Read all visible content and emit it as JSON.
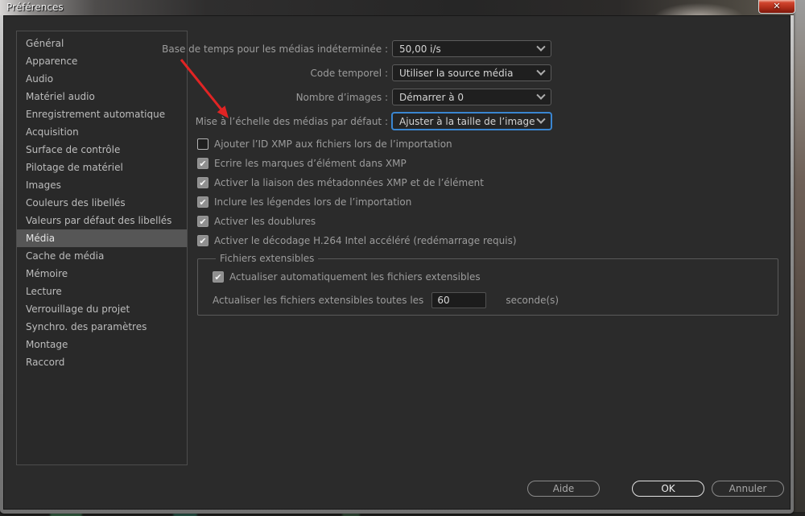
{
  "window": {
    "title": "Préférences"
  },
  "icons": {
    "close": "✕",
    "checkmark": "✔"
  },
  "sidebar": {
    "items": [
      {
        "label": "Général"
      },
      {
        "label": "Apparence"
      },
      {
        "label": "Audio"
      },
      {
        "label": "Matériel audio"
      },
      {
        "label": "Enregistrement automatique"
      },
      {
        "label": "Acquisition"
      },
      {
        "label": "Surface de contrôle"
      },
      {
        "label": "Pilotage de matériel"
      },
      {
        "label": "Images"
      },
      {
        "label": "Couleurs des libellés"
      },
      {
        "label": "Valeurs par défaut des libellés"
      },
      {
        "label": "Média",
        "selected": true
      },
      {
        "label": "Cache de média"
      },
      {
        "label": "Mémoire"
      },
      {
        "label": "Lecture"
      },
      {
        "label": "Verrouillage du projet"
      },
      {
        "label": "Synchro. des paramètres"
      },
      {
        "label": "Montage"
      },
      {
        "label": "Raccord"
      }
    ]
  },
  "main": {
    "dropdown_rows": [
      {
        "label": "Base de temps pour les médias indéterminée :",
        "value": "50,00  i/s"
      },
      {
        "label": "Code temporel :",
        "value": "Utiliser la source média"
      },
      {
        "label": "Nombre d’images :",
        "value": "Démarrer à 0"
      },
      {
        "label": "Mise à l’échelle des médias par défaut :",
        "value": "Ajuster à la taille de l’image",
        "focused": true
      }
    ],
    "checkboxes": [
      {
        "label": "Ajouter l’ID XMP aux fichiers lors de l’importation",
        "checked": false
      },
      {
        "label": "Ecrire les marques d’élément dans XMP",
        "checked": true
      },
      {
        "label": "Activer la liaison des métadonnées XMP et de l’élément",
        "checked": true
      },
      {
        "label": "Inclure les légendes lors de l’importation",
        "checked": true
      },
      {
        "label": "Activer les doublures",
        "checked": true
      },
      {
        "label": "Activer le décodage H.264 Intel accéléré (redémarrage requis)",
        "checked": true
      }
    ],
    "fieldset": {
      "legend": "Fichiers extensibles",
      "checkbox": {
        "label": "Actualiser automatiquement les fichiers extensibles",
        "checked": true
      },
      "refresh_label": "Actualiser les fichiers extensibles toutes les",
      "refresh_value": "60",
      "refresh_suffix": "seconde(s)"
    }
  },
  "footer": {
    "buttons": [
      {
        "label": "Aide"
      },
      {
        "label": "OK",
        "default": true
      },
      {
        "label": "Annuler"
      }
    ]
  },
  "annotation": {
    "type": "red-arrow",
    "points_to": "Mise à l’échelle des médias par défaut",
    "color": "#e02424"
  },
  "colors": {
    "focus_border": "#3a86d1",
    "close_button": "#b5301c",
    "selected_item": "#565656"
  }
}
